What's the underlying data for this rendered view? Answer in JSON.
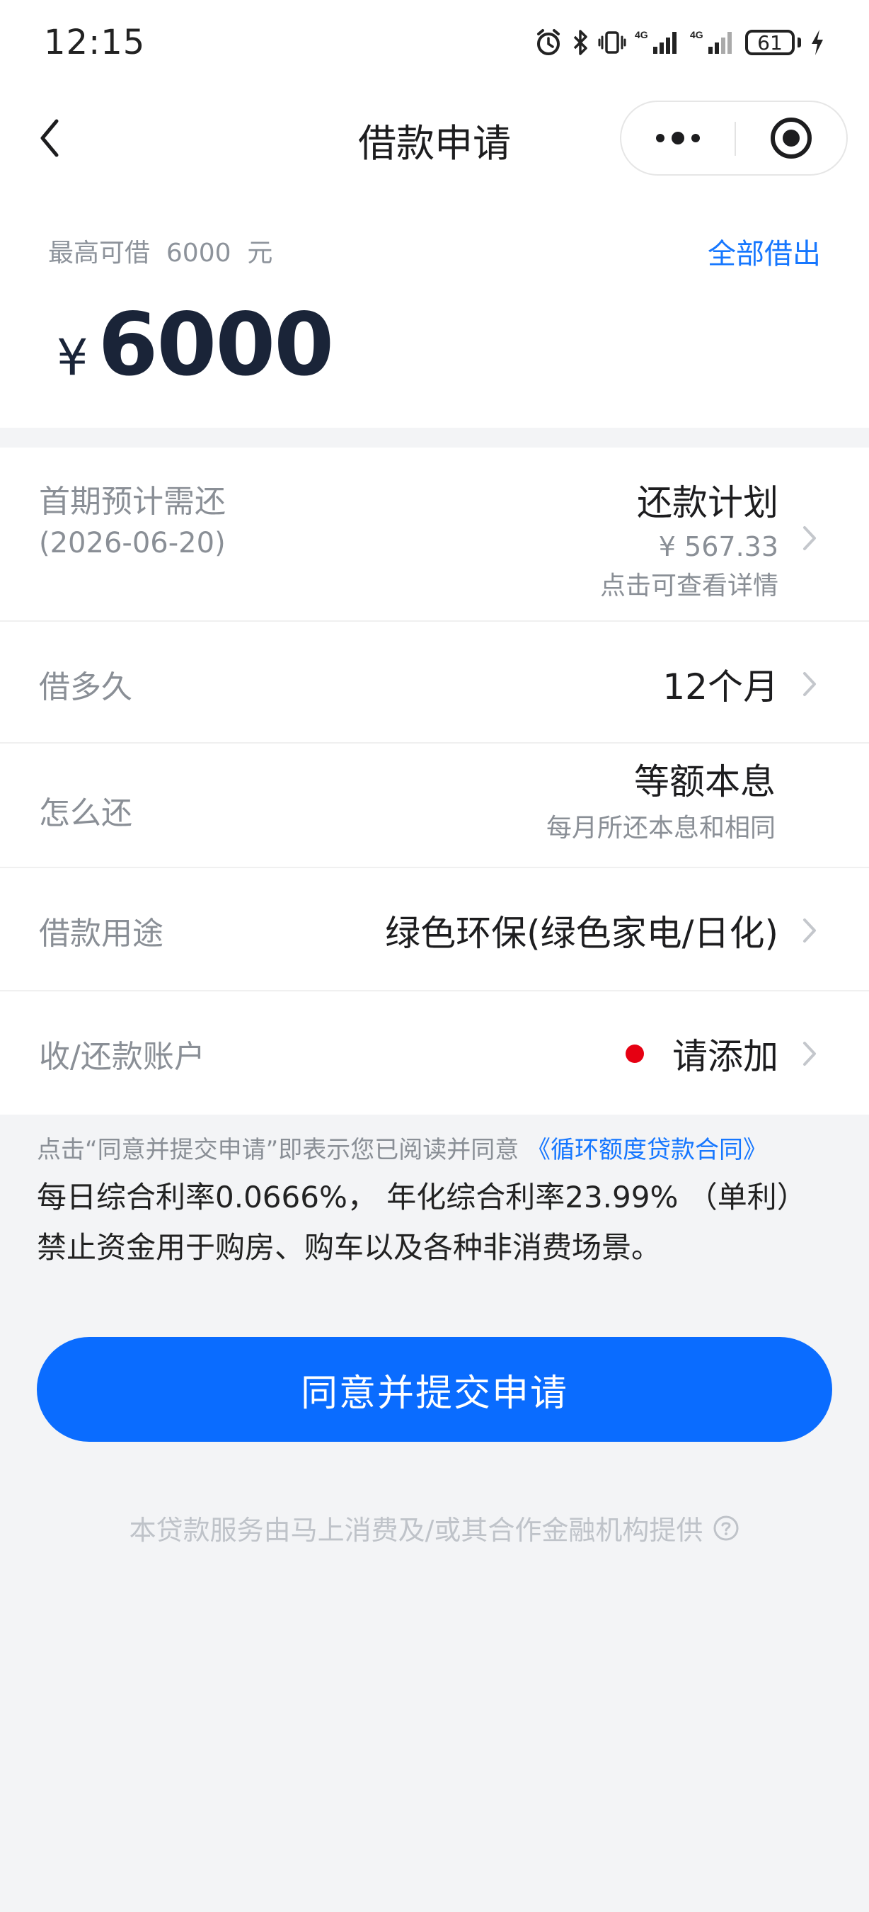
{
  "status_bar": {
    "time": "12:15",
    "battery": "61",
    "net1": "4G",
    "net2": "4G",
    "icons": [
      "alarm-icon",
      "bluetooth-icon",
      "vibrate-icon",
      "signal-icon",
      "signal-icon",
      "battery-icon",
      "charging-icon"
    ]
  },
  "nav": {
    "title": "借款申请",
    "back_icon": "chevron-left-icon",
    "more_icon": "more-dots-icon",
    "close_icon": "target-close-icon"
  },
  "amount": {
    "max_label": "最高可借  6000  元",
    "borrow_all": "全部借出",
    "currency": "¥",
    "value": "6000"
  },
  "rows": {
    "first_repay": {
      "label": "首期预计需还",
      "date": "(2026-06-20)",
      "title": "还款计划",
      "amount": "¥ 567.33",
      "hint": "点击可查看详情"
    },
    "term": {
      "label": "借多久",
      "value": "12个月"
    },
    "method": {
      "label": "怎么还",
      "value": "等额本息",
      "hint": "每月所还本息和相同"
    },
    "purpose": {
      "label": "借款用途",
      "value": "绿色环保(绿色家电/日化)"
    },
    "account": {
      "label": "收/还款账户",
      "value": "请添加"
    }
  },
  "agreement": {
    "prefix": "点击“同意并提交申请”即表示您已阅读并同意",
    "contract": "《循环额度贷款合同》",
    "rate": "每日综合利率0.0666%， 年化综合利率23.99% （单利）",
    "forbid": "禁止资金用于购房、购车以及各种非消费场景。"
  },
  "submit": {
    "label": "同意并提交申请"
  },
  "footer": {
    "text": "本贷款服务由马上消费及/或其合作金融机构提供",
    "icon": "help-icon"
  },
  "colors": {
    "accent": "#0a6cff",
    "link": "#1677ff",
    "dot": "#e60012",
    "background": "#f3f4f6"
  }
}
